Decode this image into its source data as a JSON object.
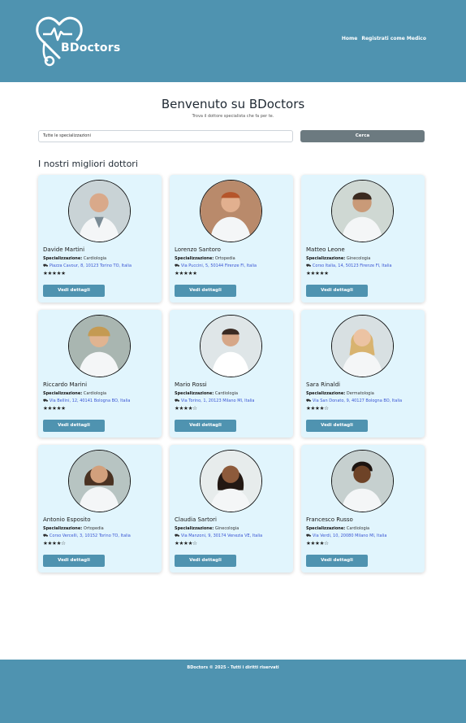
{
  "header": {
    "logo_text": "BDoctors",
    "nav": [
      {
        "label": "Home"
      },
      {
        "label": "Registrati come Medico"
      }
    ]
  },
  "hero": {
    "title": "Benvenuto su BDoctors",
    "subtitle": "Trova il dottore specialista che fa per te."
  },
  "search": {
    "select_value": "Tutte le specializzazioni",
    "button_label": "Cerca"
  },
  "section_title": "I nostri migliori dottori",
  "spec_label": "Specializzazione:",
  "detail_label": "Vedi dettagli",
  "colors": {
    "brand": "#4f93b0",
    "card_bg": "#e1f5fd",
    "search_button": "#6c7a80",
    "link": "#3a56d4"
  },
  "doctors": [
    {
      "name": "Davide Martini",
      "specialization": "Cardiologia",
      "address": "Piazza Cavour, 8, 10123 Torino TO, Italia",
      "rating": 5,
      "stars": "★★★★★"
    },
    {
      "name": "Lorenzo Santoro",
      "specialization": "Ortopedia",
      "address": "Via Puccini, 5, 50144 Firenze FI, Italia",
      "rating": 5,
      "stars": "★★★★★"
    },
    {
      "name": "Matteo Leone",
      "specialization": "Ginecologia",
      "address": "Corso Italia, 14, 50123 Firenze FI, Italia",
      "rating": 5,
      "stars": "★★★★★"
    },
    {
      "name": "Riccardo Marini",
      "specialization": "Cardiologia",
      "address": "Via Bellini, 12, 40141 Bologna BO, Italia",
      "rating": 5,
      "stars": "★★★★★"
    },
    {
      "name": "Mario Rossi",
      "specialization": "Cardiologia",
      "address": "Via Torino, 1, 20123 Milano MI, Italia",
      "rating": 3.5,
      "stars": "★★★★☆"
    },
    {
      "name": "Sara Rinaldi",
      "specialization": "Dermatologia",
      "address": "Via San Donato, 9, 40127 Bologna BO, Italia",
      "rating": 3.5,
      "stars": "★★★★☆"
    },
    {
      "name": "Antonio Esposito",
      "specialization": "Ortopedia",
      "address": "Corso Vercelli, 3, 10152 Torino TO, Italia",
      "rating": 3.5,
      "stars": "★★★★☆"
    },
    {
      "name": "Claudia Sartori",
      "specialization": "Ginecologia",
      "address": "Via Manzoni, 9, 30174 Venezia VE, Italia",
      "rating": 3.5,
      "stars": "★★★★☆"
    },
    {
      "name": "Francesco Russo",
      "specialization": "Cardiologia",
      "address": "Via Verdi, 10, 20080 Milano MI, Italia",
      "rating": 3.5,
      "stars": "★★★★☆"
    }
  ],
  "footer": {
    "text": "BDoctors © 2025 - Tutti i diritti riservati"
  }
}
